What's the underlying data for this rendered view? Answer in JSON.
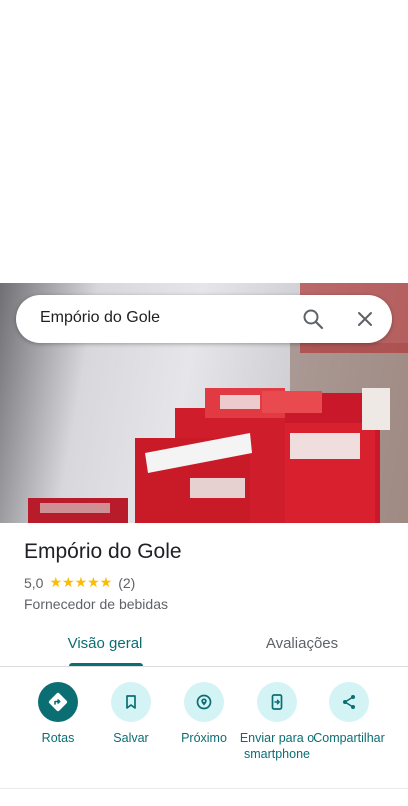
{
  "search": {
    "query": "Empório do Gole"
  },
  "place": {
    "title": "Empório do Gole",
    "rating": "5,0",
    "stars": "★★★★★",
    "review_count": "(2)",
    "category": "Fornecedor de bebidas"
  },
  "tabs": [
    {
      "label": "Visão geral",
      "active": true
    },
    {
      "label": "Avaliações",
      "active": false
    }
  ],
  "actions": [
    {
      "label": "Rotas",
      "icon": "directions-icon"
    },
    {
      "label": "Salvar",
      "icon": "bookmark-icon"
    },
    {
      "label": "Próximo",
      "icon": "nearby-icon"
    },
    {
      "label": "Enviar para o smartphone",
      "icon": "send-to-phone-icon"
    },
    {
      "label": "Compartilhar",
      "icon": "share-icon"
    }
  ],
  "colors": {
    "accent": "#0b6e73",
    "accent_light": "#d3f3f5",
    "star": "#fbbc04"
  }
}
